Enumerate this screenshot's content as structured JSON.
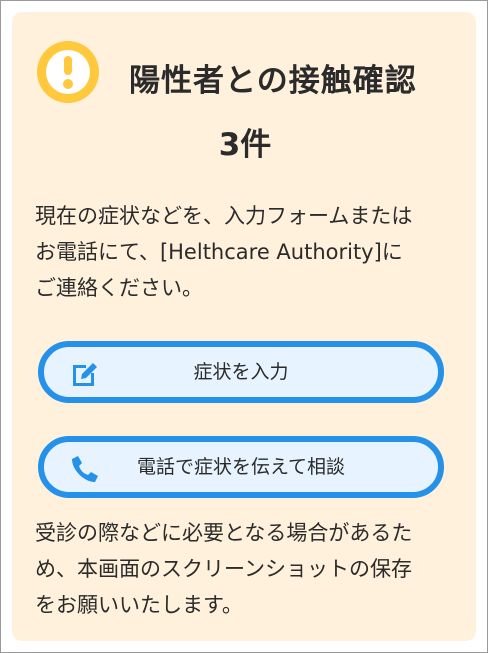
{
  "alert": {
    "icon": "exclamation-circle-icon",
    "title": "陽性者との接触確認",
    "count": "3件",
    "accent_color": "#ffc83d",
    "background_color": "#fff1dc"
  },
  "message": {
    "line1": "現在の症状などを、入力フォームまたは",
    "line2": "お電話にて、[Helthcare Authority]に",
    "line3": "ご連絡ください。"
  },
  "buttons": {
    "input_symptoms": {
      "label": "症状を入力",
      "icon": "edit-icon"
    },
    "call": {
      "label": "電話で症状を伝えて相談",
      "icon": "phone-icon"
    },
    "border_color": "#2591e8",
    "fill_color": "#e7f4ff"
  },
  "note": {
    "line1": "受診の際などに必要となる場合があるた",
    "line2": "め、本画面のスクリーンショットの保存",
    "line3": "をお願いいたします。"
  }
}
